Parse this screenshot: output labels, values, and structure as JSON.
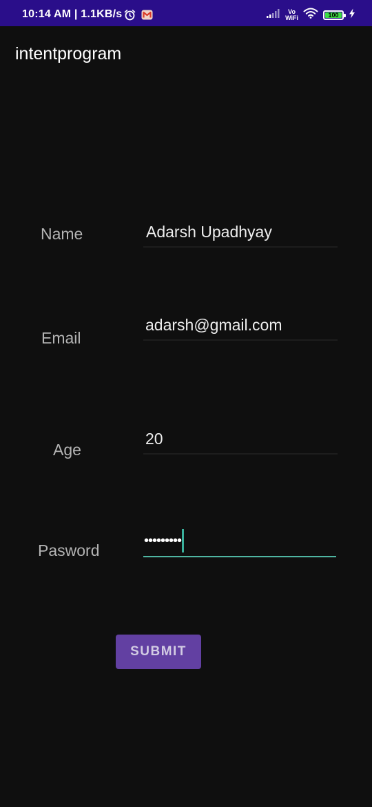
{
  "status_bar": {
    "time_speed": "10:14 AM | 1.1KB/s",
    "vowifi_top": "Vo",
    "vowifi_bottom": "WiFi",
    "battery_level": "100",
    "icons": [
      "alarm-icon",
      "gmail-icon",
      "signal-icon",
      "vowifi-icon",
      "wifi-icon",
      "battery-icon",
      "charging-icon"
    ]
  },
  "app_bar": {
    "title": "intentprogram"
  },
  "form": {
    "name": {
      "label": "Name",
      "value": "Adarsh Upadhyay"
    },
    "email": {
      "label": "Email",
      "value": "adarsh@gmail.com"
    },
    "age": {
      "label": "Age",
      "value": "20"
    },
    "password": {
      "label": "Pasword",
      "masked_value": "•••••••••"
    }
  },
  "submit_label": "SUBMIT",
  "colors": {
    "status_bar": "#2a0e8a",
    "background": "#0f0f0f",
    "button": "#6240a2",
    "focus_accent": "#4fb6a2",
    "battery_fill": "#3ddc43"
  }
}
